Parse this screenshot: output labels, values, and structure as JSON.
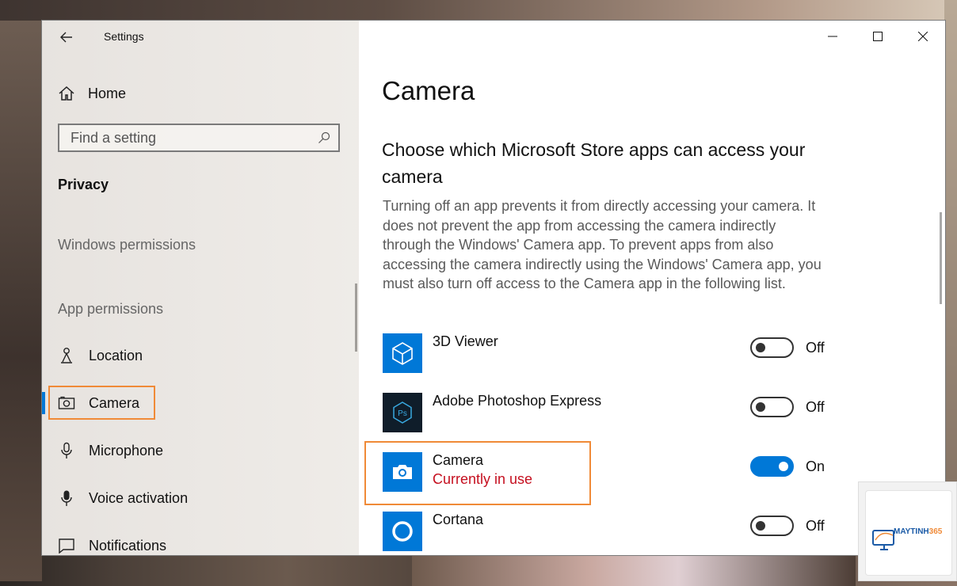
{
  "window": {
    "title": "Settings",
    "controls": [
      "minimize",
      "maximize",
      "close"
    ]
  },
  "sidebar": {
    "home_label": "Home",
    "search_placeholder": "Find a setting",
    "section_title": "Privacy",
    "groups": {
      "windows_permissions": "Windows permissions",
      "app_permissions": "App permissions"
    },
    "items": [
      {
        "label": "Location",
        "icon": "location-icon"
      },
      {
        "label": "Camera",
        "icon": "camera-icon",
        "selected": true
      },
      {
        "label": "Microphone",
        "icon": "microphone-icon"
      },
      {
        "label": "Voice activation",
        "icon": "voice-activation-icon"
      },
      {
        "label": "Notifications",
        "icon": "notifications-icon"
      }
    ]
  },
  "main": {
    "page_title": "Camera",
    "subheading": "Choose which Microsoft Store apps can access your camera",
    "description": "Turning off an app prevents it from directly accessing your camera. It does not prevent the app from accessing the camera indirectly through the Windows' Camera app. To prevent apps from also accessing the camera indirectly using the Windows' Camera app, you must also turn off access to the Camera app in the following list.",
    "apps": [
      {
        "name": "3D Viewer",
        "status": "",
        "toggle": "Off",
        "on": false,
        "icon": "3d-viewer-icon"
      },
      {
        "name": "Adobe Photoshop Express",
        "status": "",
        "toggle": "Off",
        "on": false,
        "icon": "photoshop-express-icon"
      },
      {
        "name": "Camera",
        "status": "Currently in use",
        "toggle": "On",
        "on": true,
        "icon": "camera-app-icon"
      },
      {
        "name": "Cortana",
        "status": "",
        "toggle": "Off",
        "on": false,
        "icon": "cortana-icon"
      }
    ]
  },
  "watermark": {
    "brand_a": "MAYTINH",
    "brand_b": "365"
  },
  "colors": {
    "accent": "#0078d7",
    "highlight": "#f08a37",
    "status_red": "#c50f1f"
  }
}
